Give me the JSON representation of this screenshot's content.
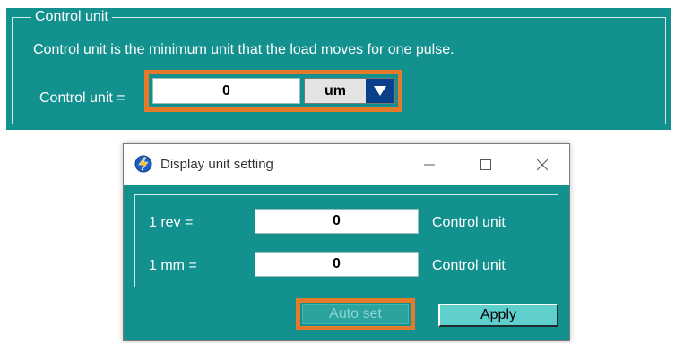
{
  "colors": {
    "panel_bg": "#13918f",
    "highlight": "#e57b2a",
    "dropdown_arrow_bg": "#0a3f8c",
    "apply_bg": "#5fcfcd"
  },
  "control_unit_panel": {
    "legend": "Control unit",
    "description": "Control unit is the minimum unit that the load moves for one pulse.",
    "label": "Control unit =",
    "value": "0",
    "unit_selected": "um",
    "dropdown_icon": "triangle-down-icon"
  },
  "dialog": {
    "title": "Display unit setting",
    "app_icon": "lightning-app-icon",
    "window_controls": [
      "minimize-icon",
      "maximize-icon",
      "close-icon"
    ],
    "rows": [
      {
        "label": "1  rev  =",
        "value": "0",
        "unit": "Control unit"
      },
      {
        "label": "1  mm  =",
        "value": "0",
        "unit": "Control unit"
      }
    ],
    "buttons": {
      "auto_set": "Auto set",
      "apply": "Apply"
    }
  }
}
